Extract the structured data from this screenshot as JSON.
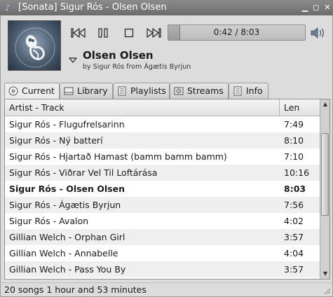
{
  "window": {
    "title": "[Sonata] Sigur Rós - Olsen Olsen",
    "app_icon": "music-note-icon",
    "buttons": [
      "minimize-icon",
      "maximize-icon",
      "close-icon"
    ]
  },
  "player": {
    "controls": [
      "previous-track-icon",
      "pause-icon",
      "stop-icon",
      "next-track-icon"
    ],
    "progress_text": "0:42 / 8:03",
    "progress_fraction": 0.087,
    "volume_icon": "volume-icon"
  },
  "now_playing": {
    "title": "Olsen Olsen",
    "subtitle": "by Sigur Rós from Ágætis Byrjun"
  },
  "tabs": [
    {
      "label": "Current",
      "icon": "disc-icon",
      "active": true
    },
    {
      "label": "Library",
      "icon": "library-icon",
      "active": false
    },
    {
      "label": "Playlists",
      "icon": "playlist-icon",
      "active": false
    },
    {
      "label": "Streams",
      "icon": "streams-icon",
      "active": false
    },
    {
      "label": "Info",
      "icon": "info-icon",
      "active": false
    }
  ],
  "playlist": {
    "columns": {
      "track": "Artist - Track",
      "length": "Len"
    },
    "rows": [
      {
        "track": "Sigur Rós - Flugufrelsarinn",
        "length": "7:49",
        "current": false
      },
      {
        "track": "Sigur Rós - Ný batterí",
        "length": "8:10",
        "current": false
      },
      {
        "track": "Sigur Rós - Hjartað Hamast (bamm bamm bamm)",
        "length": "7:10",
        "current": false
      },
      {
        "track": "Sigur Rós - Viðrar Vel Til Loftárása",
        "length": "10:16",
        "current": false
      },
      {
        "track": "Sigur Rós - Olsen Olsen",
        "length": "8:03",
        "current": true
      },
      {
        "track": "Sigur Rós - Ágætis Byrjun",
        "length": "7:56",
        "current": false
      },
      {
        "track": "Sigur Rós - Avalon",
        "length": "4:02",
        "current": false
      },
      {
        "track": "Gillian Welch - Orphan Girl",
        "length": "3:57",
        "current": false
      },
      {
        "track": "Gillian Welch - Annabelle",
        "length": "4:04",
        "current": false
      },
      {
        "track": "Gillian Welch - Pass You By",
        "length": "3:57",
        "current": false
      }
    ]
  },
  "status": {
    "text": "20 songs   1 hour and 53 minutes"
  }
}
